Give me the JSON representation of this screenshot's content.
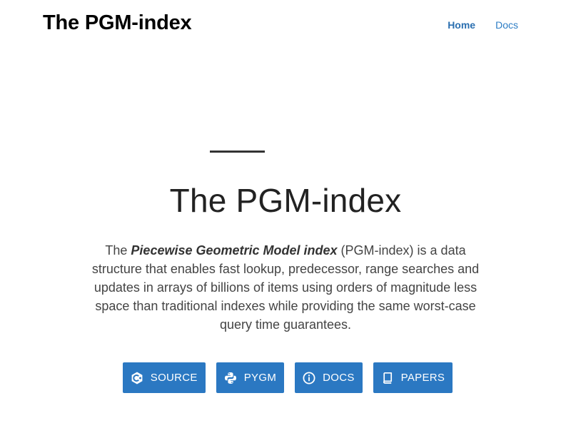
{
  "header": {
    "brand": "The PGM-index",
    "nav": [
      {
        "label": "Home",
        "active": true
      },
      {
        "label": "Docs",
        "active": false
      }
    ]
  },
  "hero": {
    "title": "The PGM-index",
    "description_prefix": "The ",
    "description_emphasis": "Piecewise Geometric Model index",
    "description_suffix": " (PGM-index) is a data structure that enables fast lookup, predecessor, range searches and updates in arrays of billions of items using orders of magnitude less space than traditional indexes while providing the same worst-case query time guarantees."
  },
  "buttons": [
    {
      "label": "SOURCE",
      "icon": "cpp-icon"
    },
    {
      "label": "PYGM",
      "icon": "python-icon"
    },
    {
      "label": "DOCS",
      "icon": "info-icon"
    },
    {
      "label": "PAPERS",
      "icon": "book-icon"
    }
  ],
  "colors": {
    "accent": "#2b78c2",
    "nav_link": "#2b7cc4",
    "text": "#222222"
  }
}
